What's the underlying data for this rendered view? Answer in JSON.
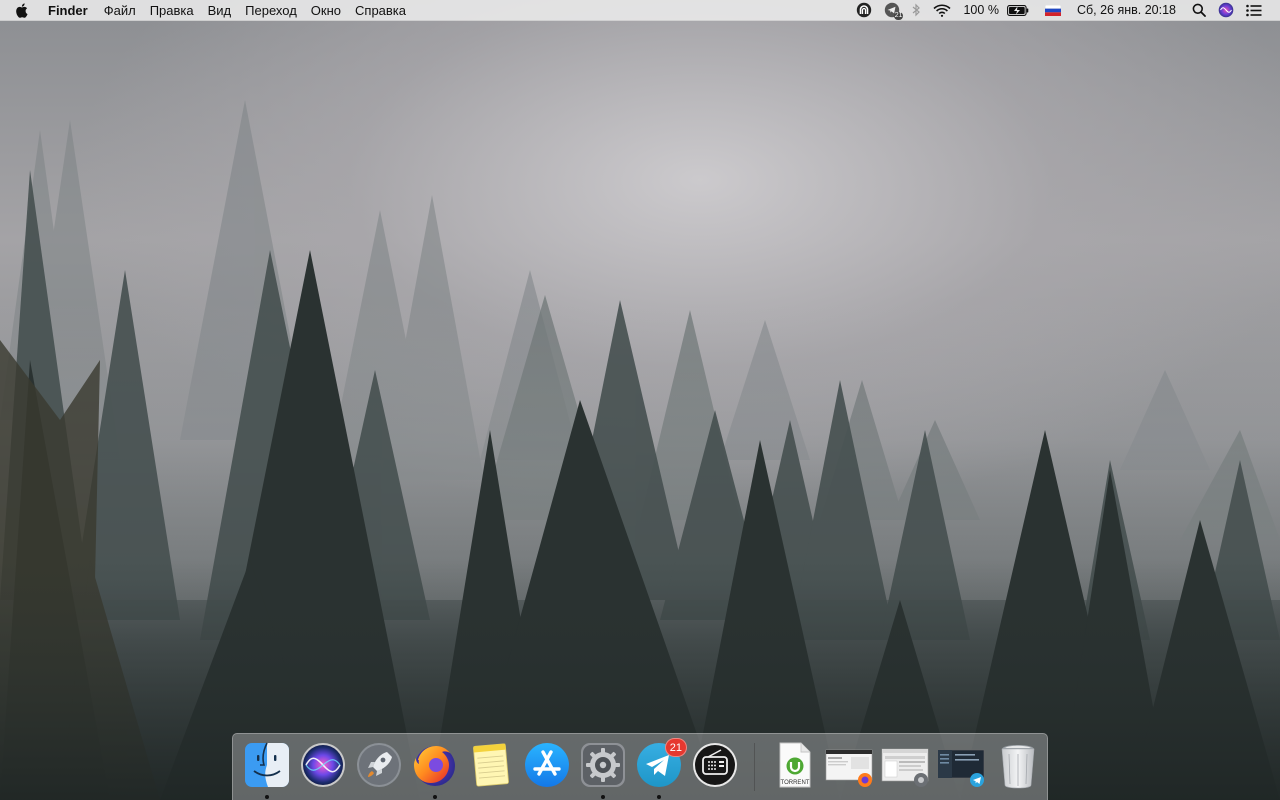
{
  "menubar": {
    "apple_icon": "apple-logo",
    "app_name": "Finder",
    "menus": [
      "Файл",
      "Правка",
      "Вид",
      "Переход",
      "Окно",
      "Справка"
    ],
    "status": {
      "vpn_icon": "tunnel-icon",
      "telegram_tray_badge": "21",
      "bluetooth_icon": "bluetooth-icon",
      "wifi_icon": "wifi-icon",
      "battery_percent": "100 %",
      "battery_level": 1.0,
      "input_source": "ru-flag",
      "datetime": "Сб, 26 янв.  20:18",
      "spotlight_icon": "search-icon",
      "siri_icon": "siri-icon",
      "notification_center_icon": "list-icon"
    }
  },
  "dock": {
    "apps": [
      {
        "name": "Finder",
        "icon": "finder-icon",
        "running": true
      },
      {
        "name": "Siri",
        "icon": "siri-icon",
        "running": false
      },
      {
        "name": "Launchpad",
        "icon": "rocket-icon",
        "running": false
      },
      {
        "name": "Firefox",
        "icon": "firefox-icon",
        "running": true
      },
      {
        "name": "Notes",
        "icon": "notes-icon",
        "running": false
      },
      {
        "name": "App Store",
        "icon": "app-store-icon",
        "running": false
      },
      {
        "name": "System Preferences",
        "icon": "gear-icon",
        "running": true
      },
      {
        "name": "Telegram",
        "icon": "telegram-icon",
        "running": true,
        "badge": "21"
      },
      {
        "name": "Radio",
        "icon": "radio-icon",
        "running": false
      }
    ],
    "others": [
      {
        "name": "torrent-file",
        "label": "TORRENT",
        "icon": "torrent-document-icon"
      },
      {
        "name": "firefox-window",
        "icon": "window-thumbnail-icon"
      },
      {
        "name": "preferences-window",
        "icon": "window-thumbnail-icon"
      },
      {
        "name": "telegram-window",
        "icon": "window-thumbnail-icon"
      },
      {
        "name": "Trash",
        "icon": "trash-icon"
      }
    ]
  },
  "colors": {
    "menubar_bg": "#ececec",
    "badge_red": "#e6382f",
    "telegram_blue": "#2aa3de",
    "appstore_blue": "#1b8ef2"
  }
}
